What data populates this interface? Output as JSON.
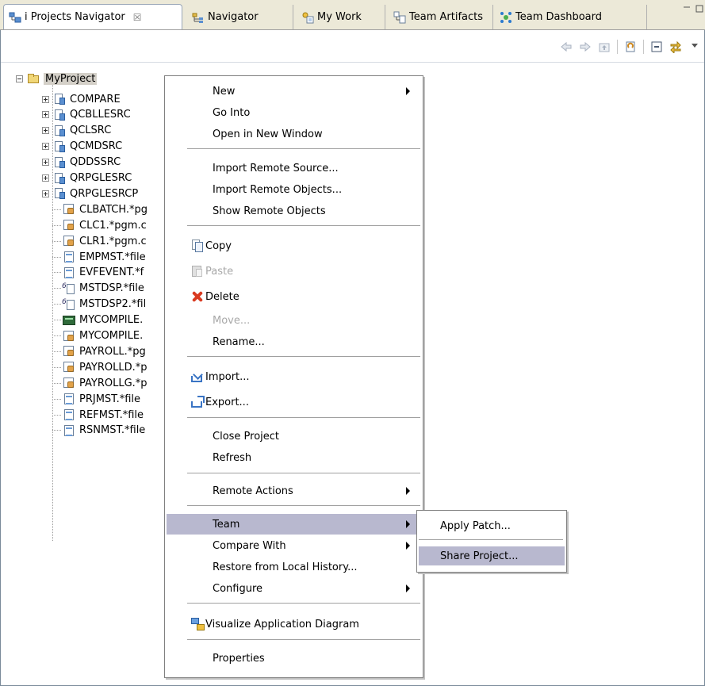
{
  "tabs": [
    {
      "label": "i Projects Navigator",
      "active": true,
      "close": "☒"
    },
    {
      "label": "Navigator"
    },
    {
      "label": "My Work"
    },
    {
      "label": "Team Artifacts"
    },
    {
      "label": "Team Dashboard"
    }
  ],
  "tree": {
    "root": "MyProject",
    "items": [
      {
        "label": "COMPARE",
        "icon": "source-pf-icon"
      },
      {
        "label": "QCBLLESRC",
        "icon": "source-pf-icon"
      },
      {
        "label": "QCLSRC",
        "icon": "source-pf-icon"
      },
      {
        "label": "QCMDSRC",
        "icon": "source-pf-icon"
      },
      {
        "label": "QDDSSRC",
        "icon": "source-pf-icon"
      },
      {
        "label": "QRPGLESRC",
        "icon": "source-pf-icon"
      },
      {
        "label": "QRPGLESRCP",
        "icon": "source-pf-icon"
      },
      {
        "label": "CLBATCH.*pg",
        "icon": "program-icon"
      },
      {
        "label": "CLC1.*pgm.c",
        "icon": "program-icon"
      },
      {
        "label": "CLR1.*pgm.c",
        "icon": "program-icon"
      },
      {
        "label": "EMPMST.*file",
        "icon": "file-icon"
      },
      {
        "label": "EVFEVENT.*f",
        "icon": "file-icon"
      },
      {
        "label": "MSTDSP.*file",
        "icon": "display-file-icon"
      },
      {
        "label": "MSTDSP2.*fil",
        "icon": "display-file-icon"
      },
      {
        "label": "MYCOMPILE.",
        "icon": "command-icon"
      },
      {
        "label": "MYCOMPILE.",
        "icon": "program-icon"
      },
      {
        "label": "PAYROLL.*pg",
        "icon": "program-icon"
      },
      {
        "label": "PAYROLLD.*p",
        "icon": "program-icon"
      },
      {
        "label": "PAYROLLG.*p",
        "icon": "program-icon"
      },
      {
        "label": "PRJMST.*file",
        "icon": "file-icon"
      },
      {
        "label": "REFMST.*file",
        "icon": "file-icon"
      },
      {
        "label": "RSNMST.*file",
        "icon": "file-icon"
      }
    ]
  },
  "menu": {
    "new": "New",
    "go_into": "Go Into",
    "open_new_window": "Open in New Window",
    "import_remote_source": "Import Remote Source...",
    "import_remote_objects": "Import Remote Objects...",
    "show_remote_objects": "Show Remote Objects",
    "copy": "Copy",
    "paste": "Paste",
    "delete": "Delete",
    "move": "Move...",
    "rename": "Rename...",
    "import": "Import...",
    "export": "Export...",
    "close_project": "Close Project",
    "refresh": "Refresh",
    "remote_actions": "Remote Actions",
    "team": "Team",
    "compare_with": "Compare With",
    "restore_local_history": "Restore from Local History...",
    "configure": "Configure",
    "visualize": "Visualize Application Diagram",
    "properties": "Properties"
  },
  "submenu": {
    "apply_patch": "Apply Patch...",
    "share_project": "Share Project..."
  },
  "colors": {
    "highlight": "#b8b8cf",
    "tabstrip": "#ece9d8"
  }
}
